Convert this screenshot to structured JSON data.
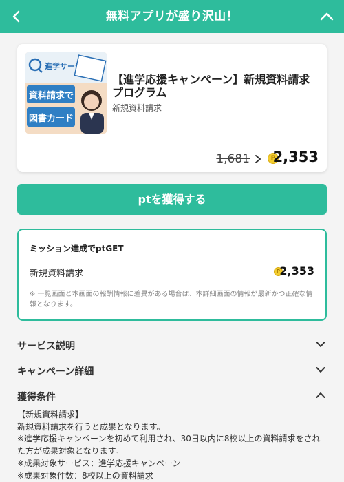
{
  "header": {
    "title": "無料アプリが盛り沢山！"
  },
  "offer": {
    "title": "【進学応援キャンペーン】新規資料請求プログラム",
    "subtitle": "新規資料請求",
    "old_points": "1,681",
    "new_points": "2,353",
    "thumb_text_1": "進学サーチ",
    "thumb_text_2": "資料請求で",
    "thumb_text_3": "図書カード"
  },
  "get_button": "ptを獲得する",
  "mission": {
    "title": "ミッション達成でptGET",
    "item_label": "新規資料請求",
    "item_points": "2,353",
    "note": "※ 一覧画面と本画面の報酬情報に差異がある場合は、本詳細画面の情報が最新かつ正確な情報となります。"
  },
  "sections": {
    "service": "サービス説明",
    "campaign": "キャンペーン詳細",
    "conditions": "獲得条件"
  },
  "conditions": {
    "heading": "【新規資料請求】",
    "line1": "新規資料請求を行うと成果となります。",
    "line2": "※進学応援キャンペーンを初めて利用され、30日以内に8校以上の資料請求をされた方が成果対象となります。",
    "line3": "※成果対象サービス：進学応援キャンペーン",
    "line4": "※成果対象件数：8校以上の資料請求"
  },
  "colors": {
    "accent": "#2ebc9c",
    "coin": "#f2cc2f"
  },
  "icons": {
    "back": "chevron-left-icon",
    "collapse": "chevron-up-icon",
    "expand": "chevron-down-icon",
    "point": "point-coin-icon"
  }
}
